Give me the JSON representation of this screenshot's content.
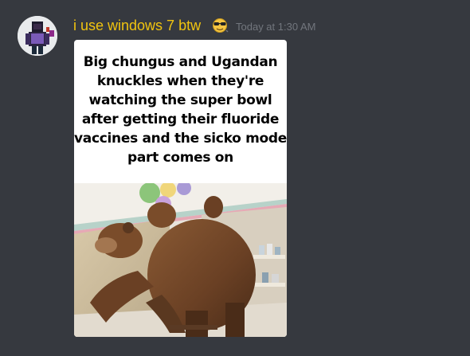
{
  "message": {
    "author": {
      "username": "i use windows 7 btw",
      "name_color": "#f1c40f",
      "badge_icon": "sunglasses-emoji-icon"
    },
    "timestamp": "Today at 1:30 AM",
    "attachment": {
      "caption": "Big chungus and Ugandan knuckles when they're watching the super bowl after getting their fluoride vaccines and the sicko mode part comes on"
    }
  },
  "theme": {
    "background": "#36393f",
    "timestamp_color": "#72767d"
  }
}
